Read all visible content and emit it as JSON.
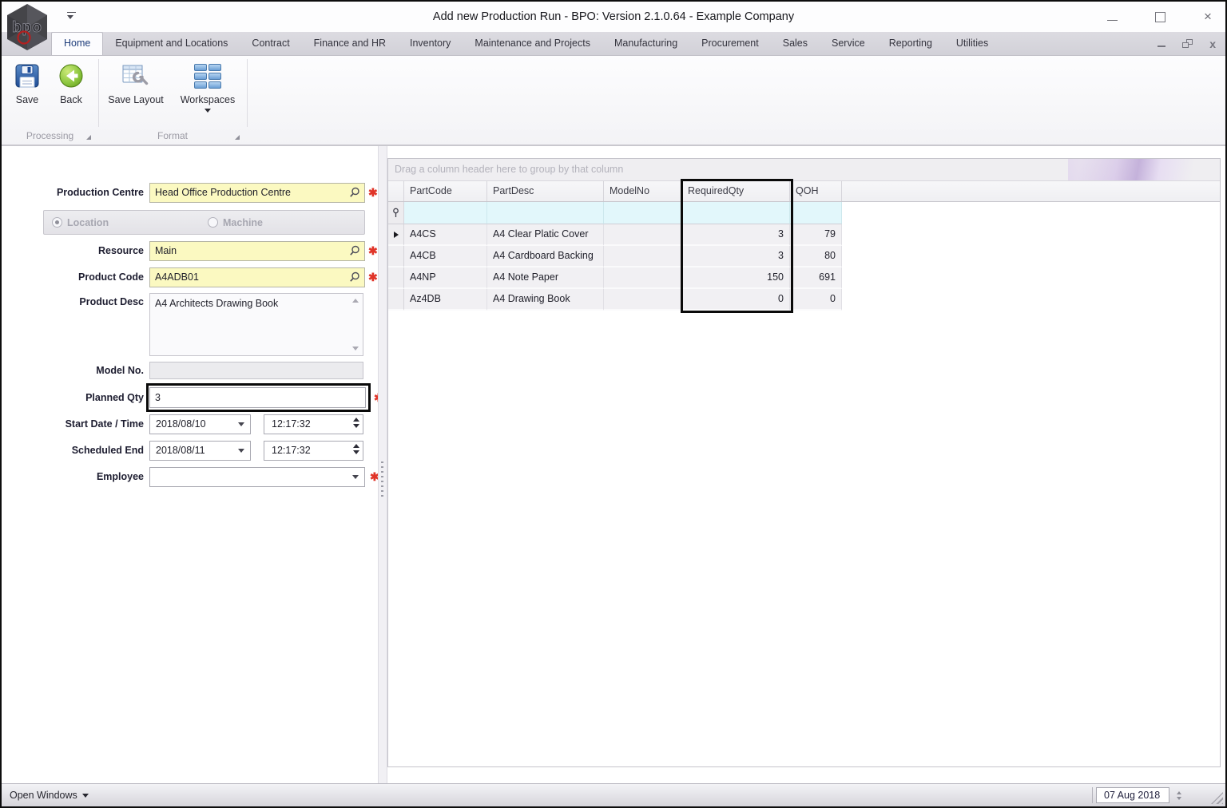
{
  "window": {
    "title": "Add new Production Run - BPO: Version 2.1.0.64 - Example Company",
    "logo_text": "bpo"
  },
  "tabs": [
    "Home",
    "Equipment and Locations",
    "Contract",
    "Finance and HR",
    "Inventory",
    "Maintenance and Projects",
    "Manufacturing",
    "Procurement",
    "Sales",
    "Service",
    "Reporting",
    "Utilities"
  ],
  "active_tab": "Home",
  "ribbon": {
    "save_label": "Save",
    "back_label": "Back",
    "save_layout_label": "Save Layout",
    "workspaces_label": "Workspaces",
    "groups": [
      "Processing",
      "Format"
    ]
  },
  "form": {
    "production_centre": {
      "label": "Production Centre",
      "value": "Head Office Production Centre"
    },
    "location_machine": {
      "location_label": "Location",
      "machine_label": "Machine",
      "selected": "Location"
    },
    "resource": {
      "label": "Resource",
      "value": "Main"
    },
    "product_code": {
      "label": "Product Code",
      "value": "A4ADB01"
    },
    "product_desc": {
      "label": "Product Desc",
      "value": "A4 Architects Drawing Book"
    },
    "model_no": {
      "label": "Model No.",
      "value": ""
    },
    "planned_qty": {
      "label": "Planned Qty",
      "value": "3"
    },
    "start": {
      "label": "Start Date / Time",
      "date": "2018/08/10",
      "time": "12:17:32"
    },
    "end": {
      "label": "Scheduled End",
      "date": "2018/08/11",
      "time": "12:17:32"
    },
    "employee": {
      "label": "Employee",
      "value": ""
    }
  },
  "grid": {
    "group_hint": "Drag a column header here to group by that column",
    "columns": [
      "PartCode",
      "PartDesc",
      "ModelNo",
      "RequiredQty",
      "QOH"
    ],
    "rows": [
      [
        "A4CS",
        "A4 Clear Platic Cover",
        "",
        "3",
        "79"
      ],
      [
        "A4CB",
        "A4 Cardboard Backing",
        "",
        "3",
        "80"
      ],
      [
        "A4NP",
        "A4 Note Paper",
        "",
        "150",
        "691"
      ],
      [
        "Az4DB",
        "A4 Drawing Book",
        "",
        "0",
        "0"
      ]
    ]
  },
  "statusbar": {
    "open_windows_label": "Open Windows",
    "date_value": "07 Aug 2018"
  },
  "colors": {
    "required_field_bg": "#fbf9c1",
    "filter_row_bg": "#e2f7fb",
    "highlight_border": "#0a0a0a",
    "required_asterisk": "#e03428",
    "back_button_green": "#8cc63f",
    "save_button_blue": "#2c5494"
  },
  "icons": {
    "logo": "bpo-hexagon",
    "qat": "chevron-down",
    "save": "floppy-disk",
    "back": "green-left-arrow",
    "save_layout": "table-with-wrench",
    "workspaces": "blue-tile-grid",
    "lookup": "magnifier",
    "dropdown": "chevron-down",
    "spinner": "up-down-arrows",
    "filter_row": "pin",
    "current_row": "right-arrow",
    "resize_grip": "diagonal-grip"
  }
}
